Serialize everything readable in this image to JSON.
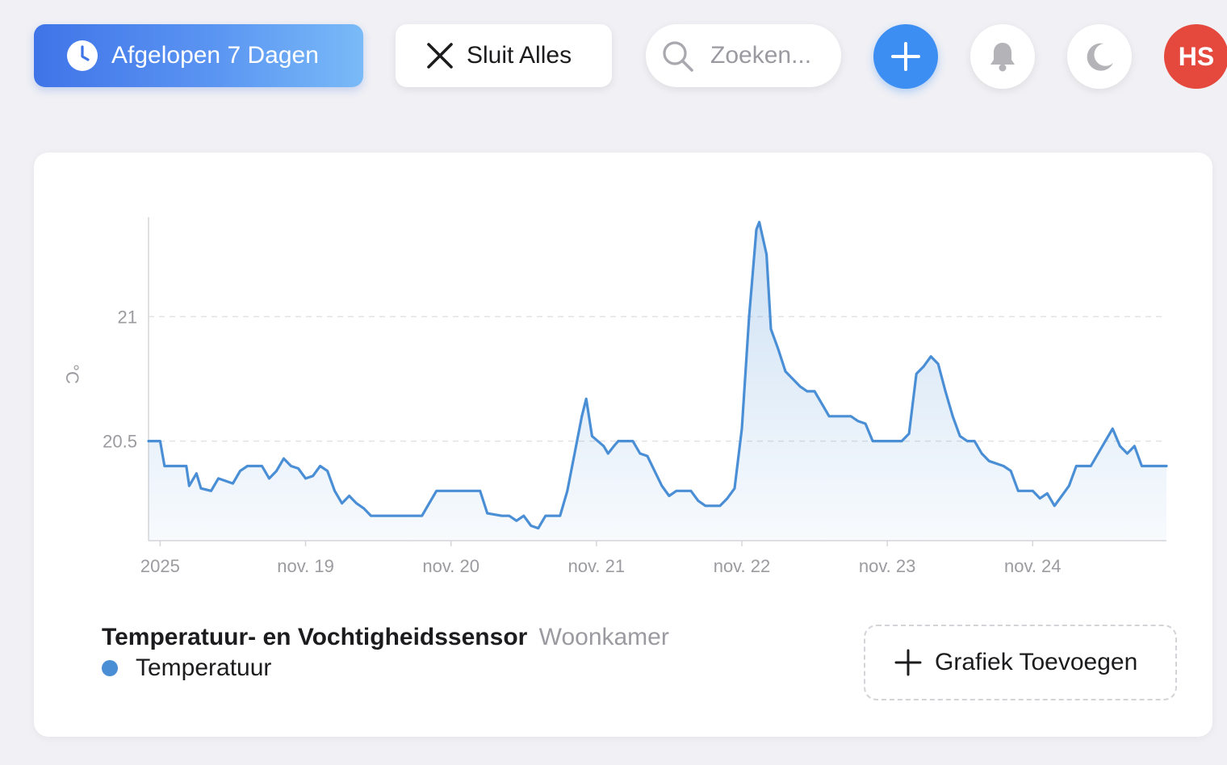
{
  "toolbar": {
    "range_label": "Afgelopen 7 Dagen",
    "close_all_label": "Sluit Alles",
    "search_placeholder": "Zoeken...",
    "avatar_initials": "HS",
    "accent_color": "#3c8ef2",
    "avatar_color": "#e5493d"
  },
  "legend": {
    "device_name": "Temperatuur- en Vochtigheidssensor",
    "area_name": "Woonkamer",
    "series_name": "Temperatuur",
    "series_color": "#4a8fd6"
  },
  "add_chart_label": "Grafiek Toevoegen",
  "chart_data": {
    "type": "area",
    "ylabel": "°C",
    "xlabel": "",
    "x_tick_labels": [
      "2025",
      "nov. 19",
      "nov. 20",
      "nov. 21",
      "nov. 22",
      "nov. 23",
      "nov. 24"
    ],
    "y_ticks": [
      20.5,
      21
    ],
    "ylim": [
      20.1,
      21.4
    ],
    "xlim": [
      -0.08,
      6.92
    ],
    "grid": true,
    "series": [
      {
        "name": "Temperatuur",
        "color": "#4a8fd6",
        "points": [
          [
            -0.08,
            20.5
          ],
          [
            0.0,
            20.5
          ],
          [
            0.03,
            20.4
          ],
          [
            0.18,
            20.4
          ],
          [
            0.2,
            20.32
          ],
          [
            0.25,
            20.37
          ],
          [
            0.28,
            20.31
          ],
          [
            0.35,
            20.3
          ],
          [
            0.4,
            20.35
          ],
          [
            0.45,
            20.34
          ],
          [
            0.5,
            20.33
          ],
          [
            0.55,
            20.38
          ],
          [
            0.6,
            20.4
          ],
          [
            0.7,
            20.4
          ],
          [
            0.75,
            20.35
          ],
          [
            0.8,
            20.38
          ],
          [
            0.85,
            20.43
          ],
          [
            0.9,
            20.4
          ],
          [
            0.95,
            20.39
          ],
          [
            1.0,
            20.35
          ],
          [
            1.05,
            20.36
          ],
          [
            1.1,
            20.4
          ],
          [
            1.15,
            20.38
          ],
          [
            1.2,
            20.3
          ],
          [
            1.25,
            20.25
          ],
          [
            1.3,
            20.28
          ],
          [
            1.35,
            20.25
          ],
          [
            1.4,
            20.23
          ],
          [
            1.45,
            20.2
          ],
          [
            1.55,
            20.2
          ],
          [
            1.7,
            20.2
          ],
          [
            1.8,
            20.2
          ],
          [
            1.85,
            20.25
          ],
          [
            1.9,
            20.3
          ],
          [
            2.1,
            20.3
          ],
          [
            2.2,
            20.3
          ],
          [
            2.25,
            20.21
          ],
          [
            2.35,
            20.2
          ],
          [
            2.4,
            20.2
          ],
          [
            2.45,
            20.18
          ],
          [
            2.5,
            20.2
          ],
          [
            2.55,
            20.16
          ],
          [
            2.6,
            20.15
          ],
          [
            2.65,
            20.2
          ],
          [
            2.75,
            20.2
          ],
          [
            2.8,
            20.3
          ],
          [
            2.85,
            20.45
          ],
          [
            2.9,
            20.6
          ],
          [
            2.93,
            20.67
          ],
          [
            2.97,
            20.52
          ],
          [
            3.05,
            20.48
          ],
          [
            3.08,
            20.45
          ],
          [
            3.12,
            20.48
          ],
          [
            3.15,
            20.5
          ],
          [
            3.25,
            20.5
          ],
          [
            3.3,
            20.45
          ],
          [
            3.35,
            20.44
          ],
          [
            3.4,
            20.38
          ],
          [
            3.45,
            20.32
          ],
          [
            3.5,
            20.28
          ],
          [
            3.55,
            20.3
          ],
          [
            3.65,
            20.3
          ],
          [
            3.7,
            20.26
          ],
          [
            3.75,
            20.24
          ],
          [
            3.85,
            20.24
          ],
          [
            3.9,
            20.27
          ],
          [
            3.95,
            20.31
          ],
          [
            4.0,
            20.55
          ],
          [
            4.05,
            21.0
          ],
          [
            4.1,
            21.35
          ],
          [
            4.12,
            21.38
          ],
          [
            4.17,
            21.25
          ],
          [
            4.2,
            20.95
          ],
          [
            4.25,
            20.87
          ],
          [
            4.3,
            20.78
          ],
          [
            4.35,
            20.75
          ],
          [
            4.4,
            20.72
          ],
          [
            4.45,
            20.7
          ],
          [
            4.5,
            20.7
          ],
          [
            4.55,
            20.65
          ],
          [
            4.6,
            20.6
          ],
          [
            4.7,
            20.6
          ],
          [
            4.75,
            20.6
          ],
          [
            4.8,
            20.58
          ],
          [
            4.85,
            20.57
          ],
          [
            4.9,
            20.5
          ],
          [
            5.1,
            20.5
          ],
          [
            5.15,
            20.53
          ],
          [
            5.2,
            20.77
          ],
          [
            5.25,
            20.8
          ],
          [
            5.3,
            20.84
          ],
          [
            5.35,
            20.81
          ],
          [
            5.4,
            20.7
          ],
          [
            5.45,
            20.6
          ],
          [
            5.5,
            20.52
          ],
          [
            5.55,
            20.5
          ],
          [
            5.6,
            20.5
          ],
          [
            5.65,
            20.45
          ],
          [
            5.7,
            20.42
          ],
          [
            5.8,
            20.4
          ],
          [
            5.85,
            20.38
          ],
          [
            5.9,
            20.3
          ],
          [
            5.95,
            20.3
          ],
          [
            6.0,
            20.3
          ],
          [
            6.05,
            20.27
          ],
          [
            6.1,
            20.29
          ],
          [
            6.15,
            20.24
          ],
          [
            6.2,
            20.28
          ],
          [
            6.25,
            20.32
          ],
          [
            6.3,
            20.4
          ],
          [
            6.35,
            20.4
          ],
          [
            6.4,
            20.4
          ],
          [
            6.45,
            20.45
          ],
          [
            6.5,
            20.5
          ],
          [
            6.55,
            20.55
          ],
          [
            6.6,
            20.48
          ],
          [
            6.65,
            20.45
          ],
          [
            6.7,
            20.48
          ],
          [
            6.75,
            20.4
          ],
          [
            6.8,
            20.4
          ],
          [
            6.9,
            20.4
          ],
          [
            6.92,
            20.4
          ]
        ]
      }
    ]
  }
}
